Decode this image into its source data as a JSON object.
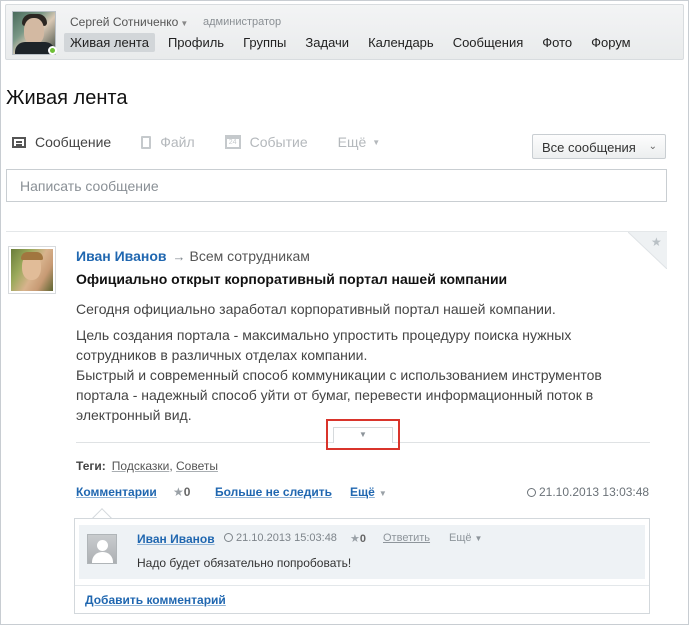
{
  "header": {
    "user_name": "Сергей Сотниченко",
    "user_role": "администратор",
    "nav": [
      {
        "label": "Живая лента",
        "active": true
      },
      {
        "label": "Профиль"
      },
      {
        "label": "Группы"
      },
      {
        "label": "Задачи"
      },
      {
        "label": "Календарь"
      },
      {
        "label": "Сообщения"
      },
      {
        "label": "Фото"
      },
      {
        "label": "Форум"
      }
    ]
  },
  "page_title": "Живая лента",
  "composer": {
    "tabs": {
      "message": "Сообщение",
      "file": "Файл",
      "event": "Событие",
      "more": "Ещё"
    },
    "calendar_day": "24",
    "filter_value": "Все сообщения",
    "placeholder": "Написать сообщение"
  },
  "post": {
    "author": "Иван Иванов",
    "arrow": "→",
    "recipient": "Всем сотрудникам",
    "title": "Официально открыт корпоративный портал нашей компании",
    "paragraphs": [
      "Сегодня официально заработал корпоративный портал нашей компании.",
      "Цель создания портала - максимально упростить процедуру поиска нужных сотрудников в различных отделах компании.",
      "Быстрый и современный способ коммуникации с использованием инструментов портала - надежный способ уйти от бумаг, перевести информационный поток в электронный вид."
    ],
    "tags_label": "Теги:",
    "tags": [
      "Подсказки",
      "Советы"
    ],
    "actions": {
      "comments": "Комментарии",
      "likes": "0",
      "unfollow": "Больше не следить",
      "more": "Ещё",
      "date": "21.10.2013 13:03:48"
    }
  },
  "comments": [
    {
      "author": "Иван Иванов",
      "date": "21.10.2013 15:03:48",
      "likes": "0",
      "reply": "Ответить",
      "more": "Ещё",
      "text": "Надо будет обязательно попробовать!"
    }
  ],
  "add_comment": "Добавить комментарий",
  "colors": {
    "link": "#2067b0",
    "highlight": "#d9342b",
    "online": "#6fbf37"
  }
}
